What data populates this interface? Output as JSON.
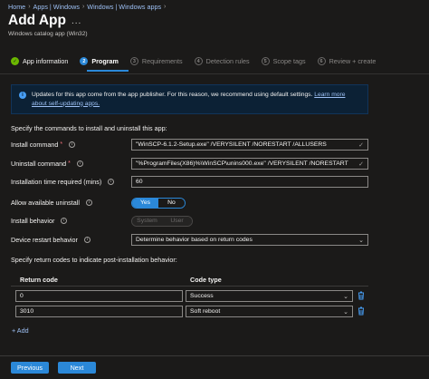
{
  "breadcrumb": [
    "Home",
    "Apps | Windows",
    "Windows | Windows apps"
  ],
  "page": {
    "title": "Add App",
    "more": "...",
    "subtitle": "Windows catalog app (Win32)"
  },
  "steps": [
    {
      "label": "App information",
      "marker": "✓"
    },
    {
      "label": "Program",
      "marker": "2"
    },
    {
      "label": "Requirements",
      "marker": "3"
    },
    {
      "label": "Detection rules",
      "marker": "4"
    },
    {
      "label": "Scope tags",
      "marker": "5"
    },
    {
      "label": "Review + create",
      "marker": "6"
    }
  ],
  "info": {
    "icon": "i",
    "text": "Updates for this app come from the app publisher. For this reason, we recommend using default settings.",
    "link": "Learn more about self-updating apps."
  },
  "commands_heading": "Specify the commands to install and uninstall this app:",
  "form": {
    "install_label": "Install command",
    "install_value": "\"WinSCP-6.1.2-Setup.exe\" /VERYSILENT /NORESTART /ALLUSERS",
    "uninstall_label": "Uninstall command",
    "uninstall_value": "\"%ProgramFiles(X86)%\\WinSCP\\unins000.exe\" /VERYSILENT /NORESTART",
    "time_label": "Installation time required (mins)",
    "time_value": "60",
    "allow_uninstall_label": "Allow available uninstall",
    "yes": "Yes",
    "no": "No",
    "behavior_label": "Install behavior",
    "system": "System",
    "user": "User",
    "restart_label": "Device restart behavior",
    "restart_value": "Determine behavior based on return codes",
    "required": "*",
    "info_icon": "i",
    "check": "✓",
    "chevron": "⌄"
  },
  "return_codes": {
    "heading": "Specify return codes to indicate post-installation behavior:",
    "col_code": "Return code",
    "col_type": "Code type",
    "rows": [
      {
        "code": "0",
        "type": "Success"
      },
      {
        "code": "3010",
        "type": "Soft reboot"
      }
    ],
    "add": "+ Add"
  },
  "footer": {
    "previous": "Previous",
    "next": "Next"
  },
  "colors": {
    "accent": "#2b88d8",
    "success": "#6bb700",
    "background": "#1b1a19"
  }
}
